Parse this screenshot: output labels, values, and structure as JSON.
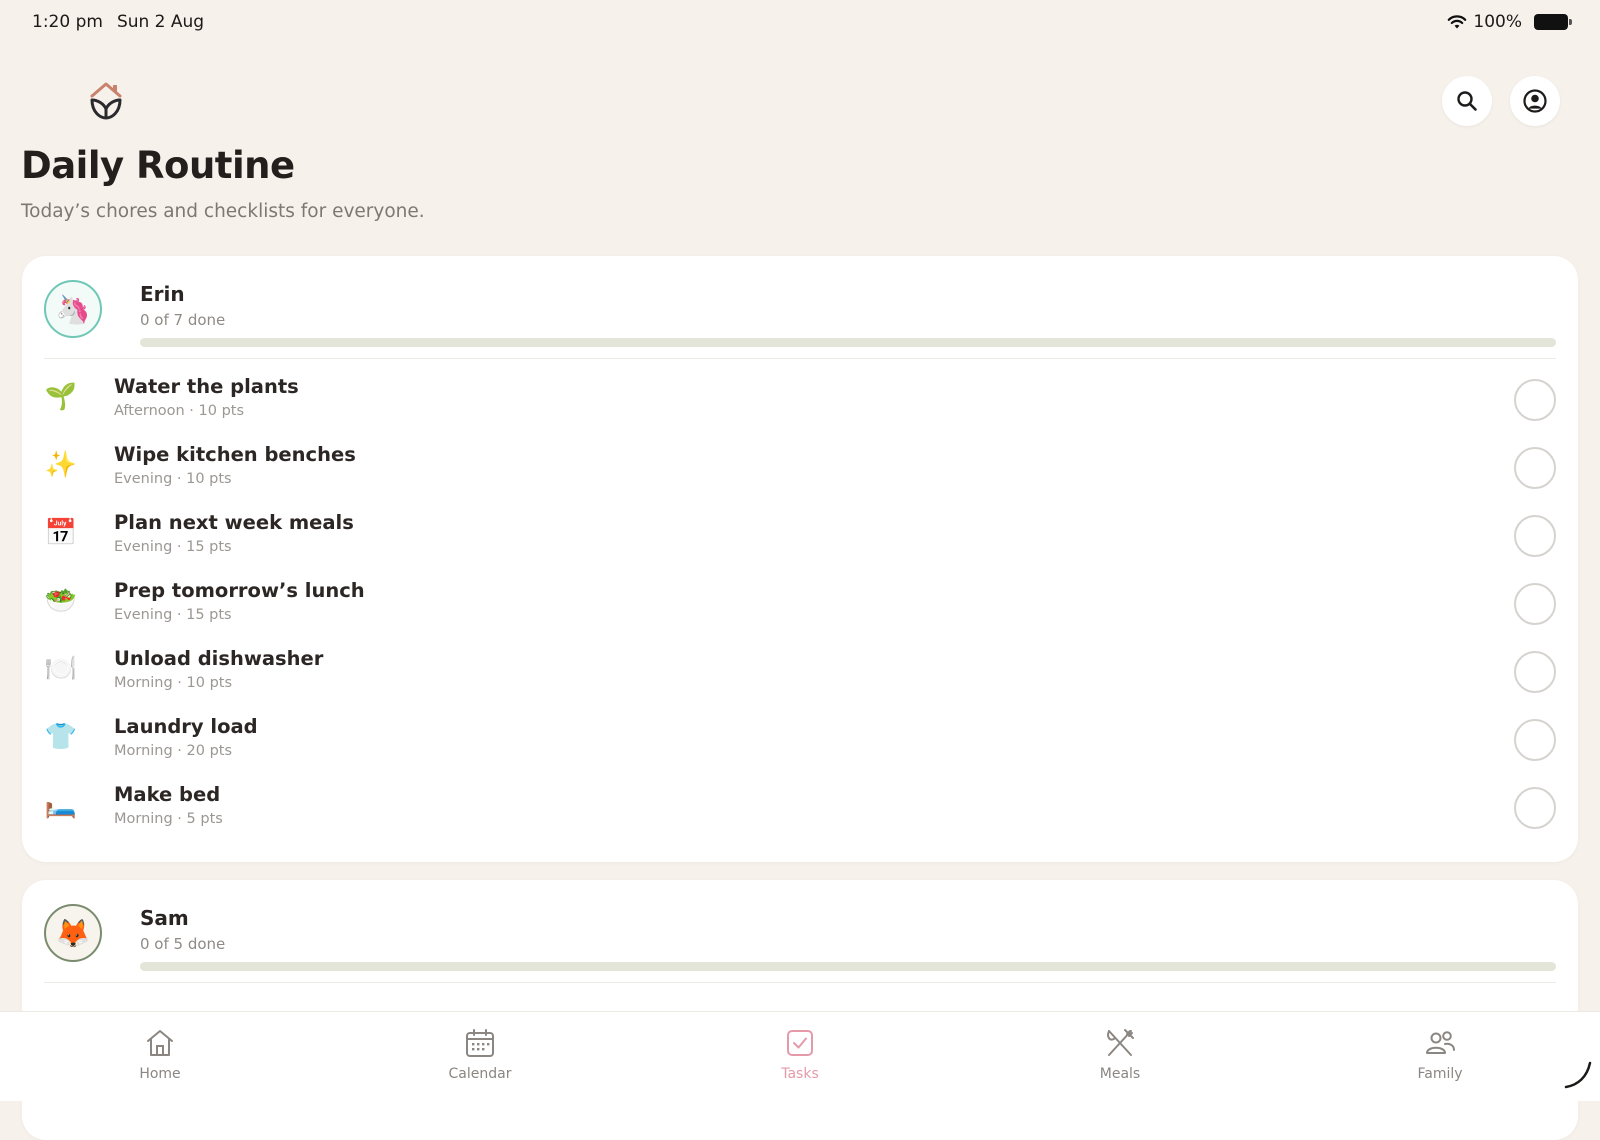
{
  "status_bar": {
    "time": "1:20 pm",
    "date": "Sun 2 Aug",
    "battery": "100%"
  },
  "header": {
    "title": "Daily Routine",
    "subtitle": "Today’s chores and checklists for everyone."
  },
  "members": [
    {
      "name": "Erin",
      "avatar": "🦄",
      "progress_text": "0 of 7 done",
      "progress_fraction": 0,
      "tasks": [
        {
          "icon": "🌱",
          "icon_name": "seedling-icon",
          "title": "Water the plants",
          "meta": "Afternoon · 10 pts"
        },
        {
          "icon": "✨",
          "icon_name": "sparkles-icon",
          "title": "Wipe kitchen benches",
          "meta": "Evening · 10 pts"
        },
        {
          "icon": "📅",
          "icon_name": "calendar-17-icon",
          "title": "Plan next week meals",
          "meta": "Evening · 15 pts"
        },
        {
          "icon": "🥗",
          "icon_name": "salad-icon",
          "title": "Prep tomorrow’s lunch",
          "meta": "Evening · 15 pts"
        },
        {
          "icon": "🍽️",
          "icon_name": "plate-cutlery-icon",
          "title": "Unload dishwasher",
          "meta": "Morning · 10 pts"
        },
        {
          "icon": "👕",
          "icon_name": "tshirt-icon",
          "title": "Laundry load",
          "meta": "Morning · 20 pts"
        },
        {
          "icon": "🛏️",
          "icon_name": "bed-icon",
          "title": "Make bed",
          "meta": "Morning · 5 pts"
        }
      ]
    },
    {
      "name": "Sam",
      "avatar": "🦊",
      "progress_text": "0 of 5 done",
      "progress_fraction": 0,
      "tasks": []
    }
  ],
  "tabs": [
    {
      "label": "Home",
      "icon": "home-icon",
      "active": false
    },
    {
      "label": "Calendar",
      "icon": "calendar-icon",
      "active": false
    },
    {
      "label": "Tasks",
      "icon": "checkbox-icon",
      "active": true
    },
    {
      "label": "Meals",
      "icon": "utensils-icon",
      "active": false
    },
    {
      "label": "Family",
      "icon": "people-icon",
      "active": false
    }
  ],
  "colors": {
    "background": "#f6f1eb",
    "accent_active_tab": "#e59aa9",
    "progress_track": "#e2e5d7",
    "erin_avatar_ring": "#6fc7b6",
    "sam_avatar_ring": "#7a8b6e"
  }
}
